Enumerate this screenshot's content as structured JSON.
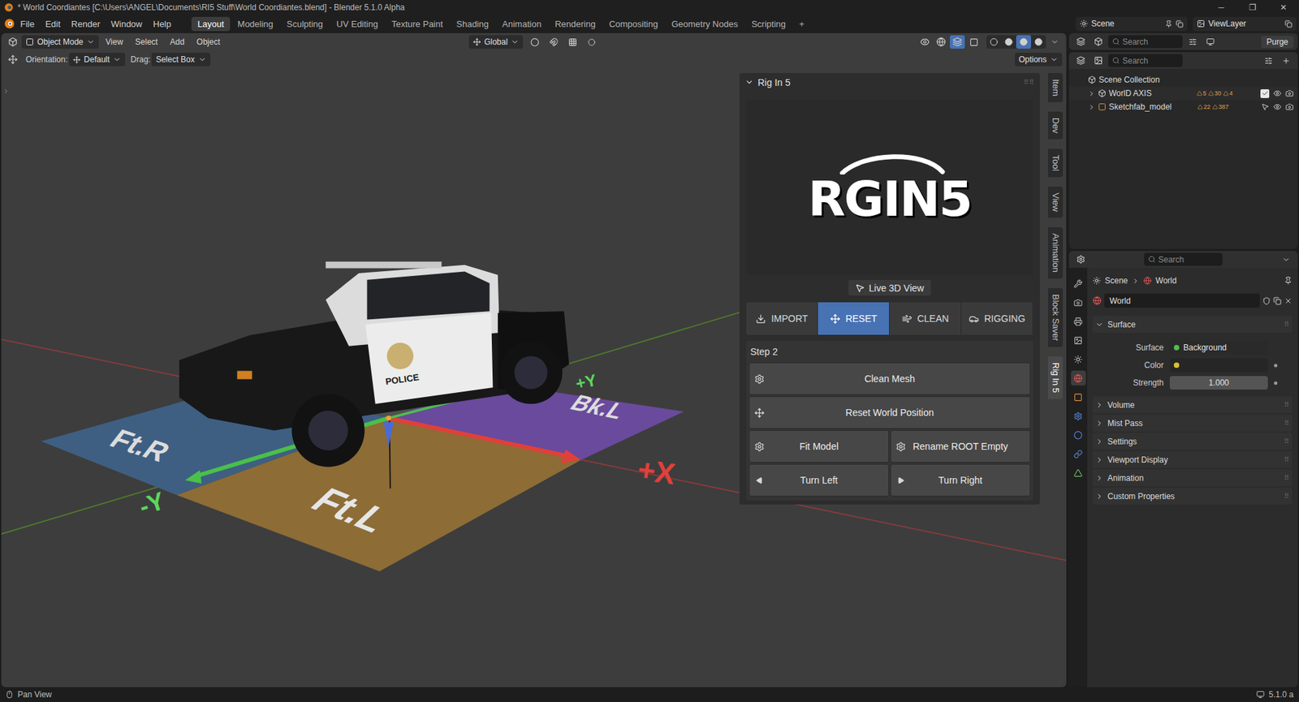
{
  "window": {
    "title": "* World Coordiantes [C:\\Users\\ANGEL\\Documents\\RI5 Stuff\\World Coordiantes.blend] - Blender 5.1.0 Alpha",
    "controls": [
      "─",
      "❐",
      "✕"
    ]
  },
  "menu": [
    "File",
    "Edit",
    "Render",
    "Window",
    "Help"
  ],
  "workspaces": [
    {
      "label": "Layout",
      "selected": true
    },
    {
      "label": "Modeling",
      "selected": false
    },
    {
      "label": "Sculpting",
      "selected": false
    },
    {
      "label": "UV Editing",
      "selected": false
    },
    {
      "label": "Texture Paint",
      "selected": false
    },
    {
      "label": "Shading",
      "selected": false
    },
    {
      "label": "Animation",
      "selected": false
    },
    {
      "label": "Rendering",
      "selected": false
    },
    {
      "label": "Compositing",
      "selected": false
    },
    {
      "label": "Geometry Nodes",
      "selected": false
    },
    {
      "label": "Scripting",
      "selected": false
    }
  ],
  "add_workspace": "+",
  "scene": "Scene",
  "view_layer": "ViewLayer",
  "viewport_header": {
    "mode": "Object Mode",
    "menus": [
      "View",
      "Select",
      "Add",
      "Object"
    ],
    "transform": "Global",
    "shading": [
      {
        "selected": false
      },
      {
        "selected": false
      },
      {
        "selected": true
      },
      {
        "selected": false
      }
    ]
  },
  "tool_settings": {
    "orientation_label": "Orientation:",
    "orientation": "Default",
    "drag_label": "Drag:",
    "drag": "Select Box",
    "options": "Options"
  },
  "scene_labels": [
    {
      "text": "Ft.R",
      "color": "#dcdcdc"
    },
    {
      "text": "Bk.L",
      "color": "#dcdcdc"
    },
    {
      "text": "Ft.L",
      "color": "#e6e6e6"
    },
    {
      "text": "+X",
      "color": "#e0403a"
    },
    {
      "text": "-Y",
      "color": "#5cd65c"
    },
    {
      "text": "+Y",
      "color": "#5cd65c"
    },
    {
      "text": "POLICE",
      "color": "#1a1a1a"
    }
  ],
  "sidebar_tabs": [
    {
      "label": "Item",
      "selected": false
    },
    {
      "label": "Dev",
      "selected": false
    },
    {
      "label": "Tool",
      "selected": false
    },
    {
      "label": "View",
      "selected": false
    },
    {
      "label": "Animation",
      "selected": false
    },
    {
      "label": "Block Saver",
      "selected": false
    },
    {
      "label": "Rig In 5",
      "selected": true
    }
  ],
  "rig_panel": {
    "title": "Rig In 5",
    "logo": "RGIN5",
    "live_view": "Live 3D View",
    "tabs": [
      {
        "label": "IMPORT",
        "kind": "import",
        "selected": false
      },
      {
        "label": "RESET",
        "kind": "reset",
        "selected": true
      },
      {
        "label": "CLEAN",
        "kind": "clean",
        "selected": false
      },
      {
        "label": "RIGGING",
        "kind": "rigging",
        "selected": false
      }
    ],
    "step": "Step 2",
    "rows": [
      [
        {
          "label": "Clean Mesh",
          "kind": "gear"
        }
      ],
      [
        {
          "label": "Reset World Position",
          "kind": "move"
        }
      ],
      [
        {
          "label": "Fit Model",
          "kind": "gear"
        },
        {
          "label": "Rename ROOT Empty",
          "kind": "gear"
        }
      ],
      [
        {
          "label": "Turn Left",
          "kind": "left"
        },
        {
          "label": "Turn Right",
          "kind": "right"
        }
      ]
    ]
  },
  "blend_file_view": {
    "search": "Search",
    "purge": "Purge"
  },
  "outliner": {
    "search": "Search",
    "root": "Scene Collection",
    "items": [
      {
        "name": "WorlD AXIS",
        "kind": "collection",
        "badges": [
          "5",
          "30",
          "4"
        ],
        "checked": true
      },
      {
        "name": "Sketchfab_model",
        "kind": "object",
        "badges": [
          "22",
          "387"
        ]
      }
    ]
  },
  "properties": {
    "search": "Search",
    "tabs": [
      {
        "selected": false
      },
      {
        "selected": false
      },
      {
        "selected": false
      },
      {
        "selected": false
      },
      {
        "selected": false
      },
      {
        "selected": true
      },
      {
        "selected": false
      },
      {
        "selected": false
      },
      {
        "selected": false
      },
      {
        "selected": false
      },
      {
        "selected": false
      }
    ],
    "breadcrumb": [
      "Scene",
      "World"
    ],
    "datablock": "World",
    "surface": {
      "title": "Surface",
      "expanded": true,
      "rows": [
        {
          "label": "Surface",
          "value": "Background",
          "kind": "shader"
        },
        {
          "label": "Color",
          "value": "",
          "kind": "color",
          "color": "#262626"
        },
        {
          "label": "Strength",
          "value": "1.000",
          "kind": "number"
        }
      ]
    },
    "panels": [
      {
        "title": "Volume",
        "expanded": false
      },
      {
        "title": "Mist Pass",
        "expanded": false
      },
      {
        "title": "Settings",
        "expanded": false
      },
      {
        "title": "Viewport Display",
        "expanded": false
      },
      {
        "title": "Animation",
        "expanded": false
      },
      {
        "title": "Custom Properties",
        "expanded": false
      }
    ]
  },
  "status_bar": {
    "left": "Pan View",
    "right": "5.1.0 a"
  }
}
